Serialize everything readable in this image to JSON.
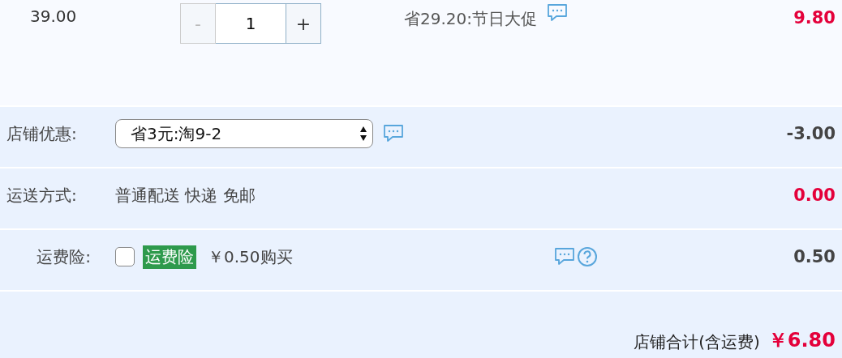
{
  "item": {
    "price": "39.00",
    "quantity": {
      "minus": "-",
      "value": "1",
      "plus": "+",
      "minus_disabled": true
    },
    "promo": "省29.20:节日大促",
    "subtotal": "9.80"
  },
  "rows": [
    {
      "kind": "select",
      "label": "店铺优惠:",
      "value": "省3元:淘9-2",
      "amount": "-3.00",
      "highlight": false
    },
    {
      "kind": "text",
      "label": "运送方式:",
      "value": "普通配送 快递 免邮",
      "amount": "0.00",
      "highlight": true
    },
    {
      "kind": "insurance",
      "label": "运费险:",
      "checked": false,
      "tag": "运费险",
      "value": "￥0.50购买",
      "amount": "0.50",
      "highlight": false
    }
  ],
  "total": {
    "label": "店铺合计(含运费)",
    "value": "￥6.80"
  }
}
